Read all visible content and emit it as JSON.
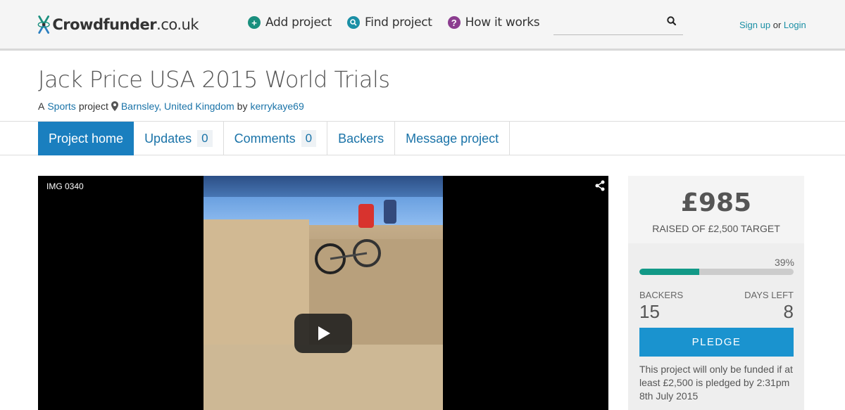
{
  "header": {
    "logo_text_bold": "Crowdfunder",
    "logo_text_light": ".co.uk",
    "nav": [
      {
        "label": "Add project",
        "icon": "plus-icon",
        "color": "#1a8f7e"
      },
      {
        "label": "Find project",
        "icon": "search-icon",
        "color": "#1a8fa5"
      },
      {
        "label": "How it works",
        "icon": "question-icon",
        "color": "#8b3d8f"
      }
    ],
    "search_placeholder": "",
    "auth_signup": "Sign up",
    "auth_or": "or",
    "auth_login": "Login"
  },
  "project": {
    "title": "Jack Price USA 2015 World Trials",
    "prefix": "A",
    "category": "Sports",
    "project_word": "project",
    "location": "Barnsley, United Kingdom",
    "by_word": "by",
    "owner": "kerrykaye69"
  },
  "tabs": [
    {
      "label": "Project home",
      "count": null,
      "active": true
    },
    {
      "label": "Updates",
      "count": "0",
      "active": false
    },
    {
      "label": "Comments",
      "count": "0",
      "active": false
    },
    {
      "label": "Backers",
      "count": null,
      "active": false
    },
    {
      "label": "Message project",
      "count": null,
      "active": false
    }
  ],
  "video": {
    "caption": "IMG 0340"
  },
  "stats": {
    "raised": "£985",
    "target": "RAISED OF £2,500 TARGET",
    "percent": "39%",
    "progress_fraction": 0.39,
    "backers_label": "BACKERS",
    "backers": "15",
    "days_label": "DAYS LEFT",
    "days": "8",
    "pledge_label": "PLEDGE",
    "note": "This project will only be funded if at least £2,500 is pledged by 2:31pm 8th July 2015"
  },
  "colors": {
    "accent_blue": "#1a7fbf",
    "pledge_blue": "#1a93cf",
    "progress_green": "#129987",
    "link_teal": "#1a8fa5"
  }
}
